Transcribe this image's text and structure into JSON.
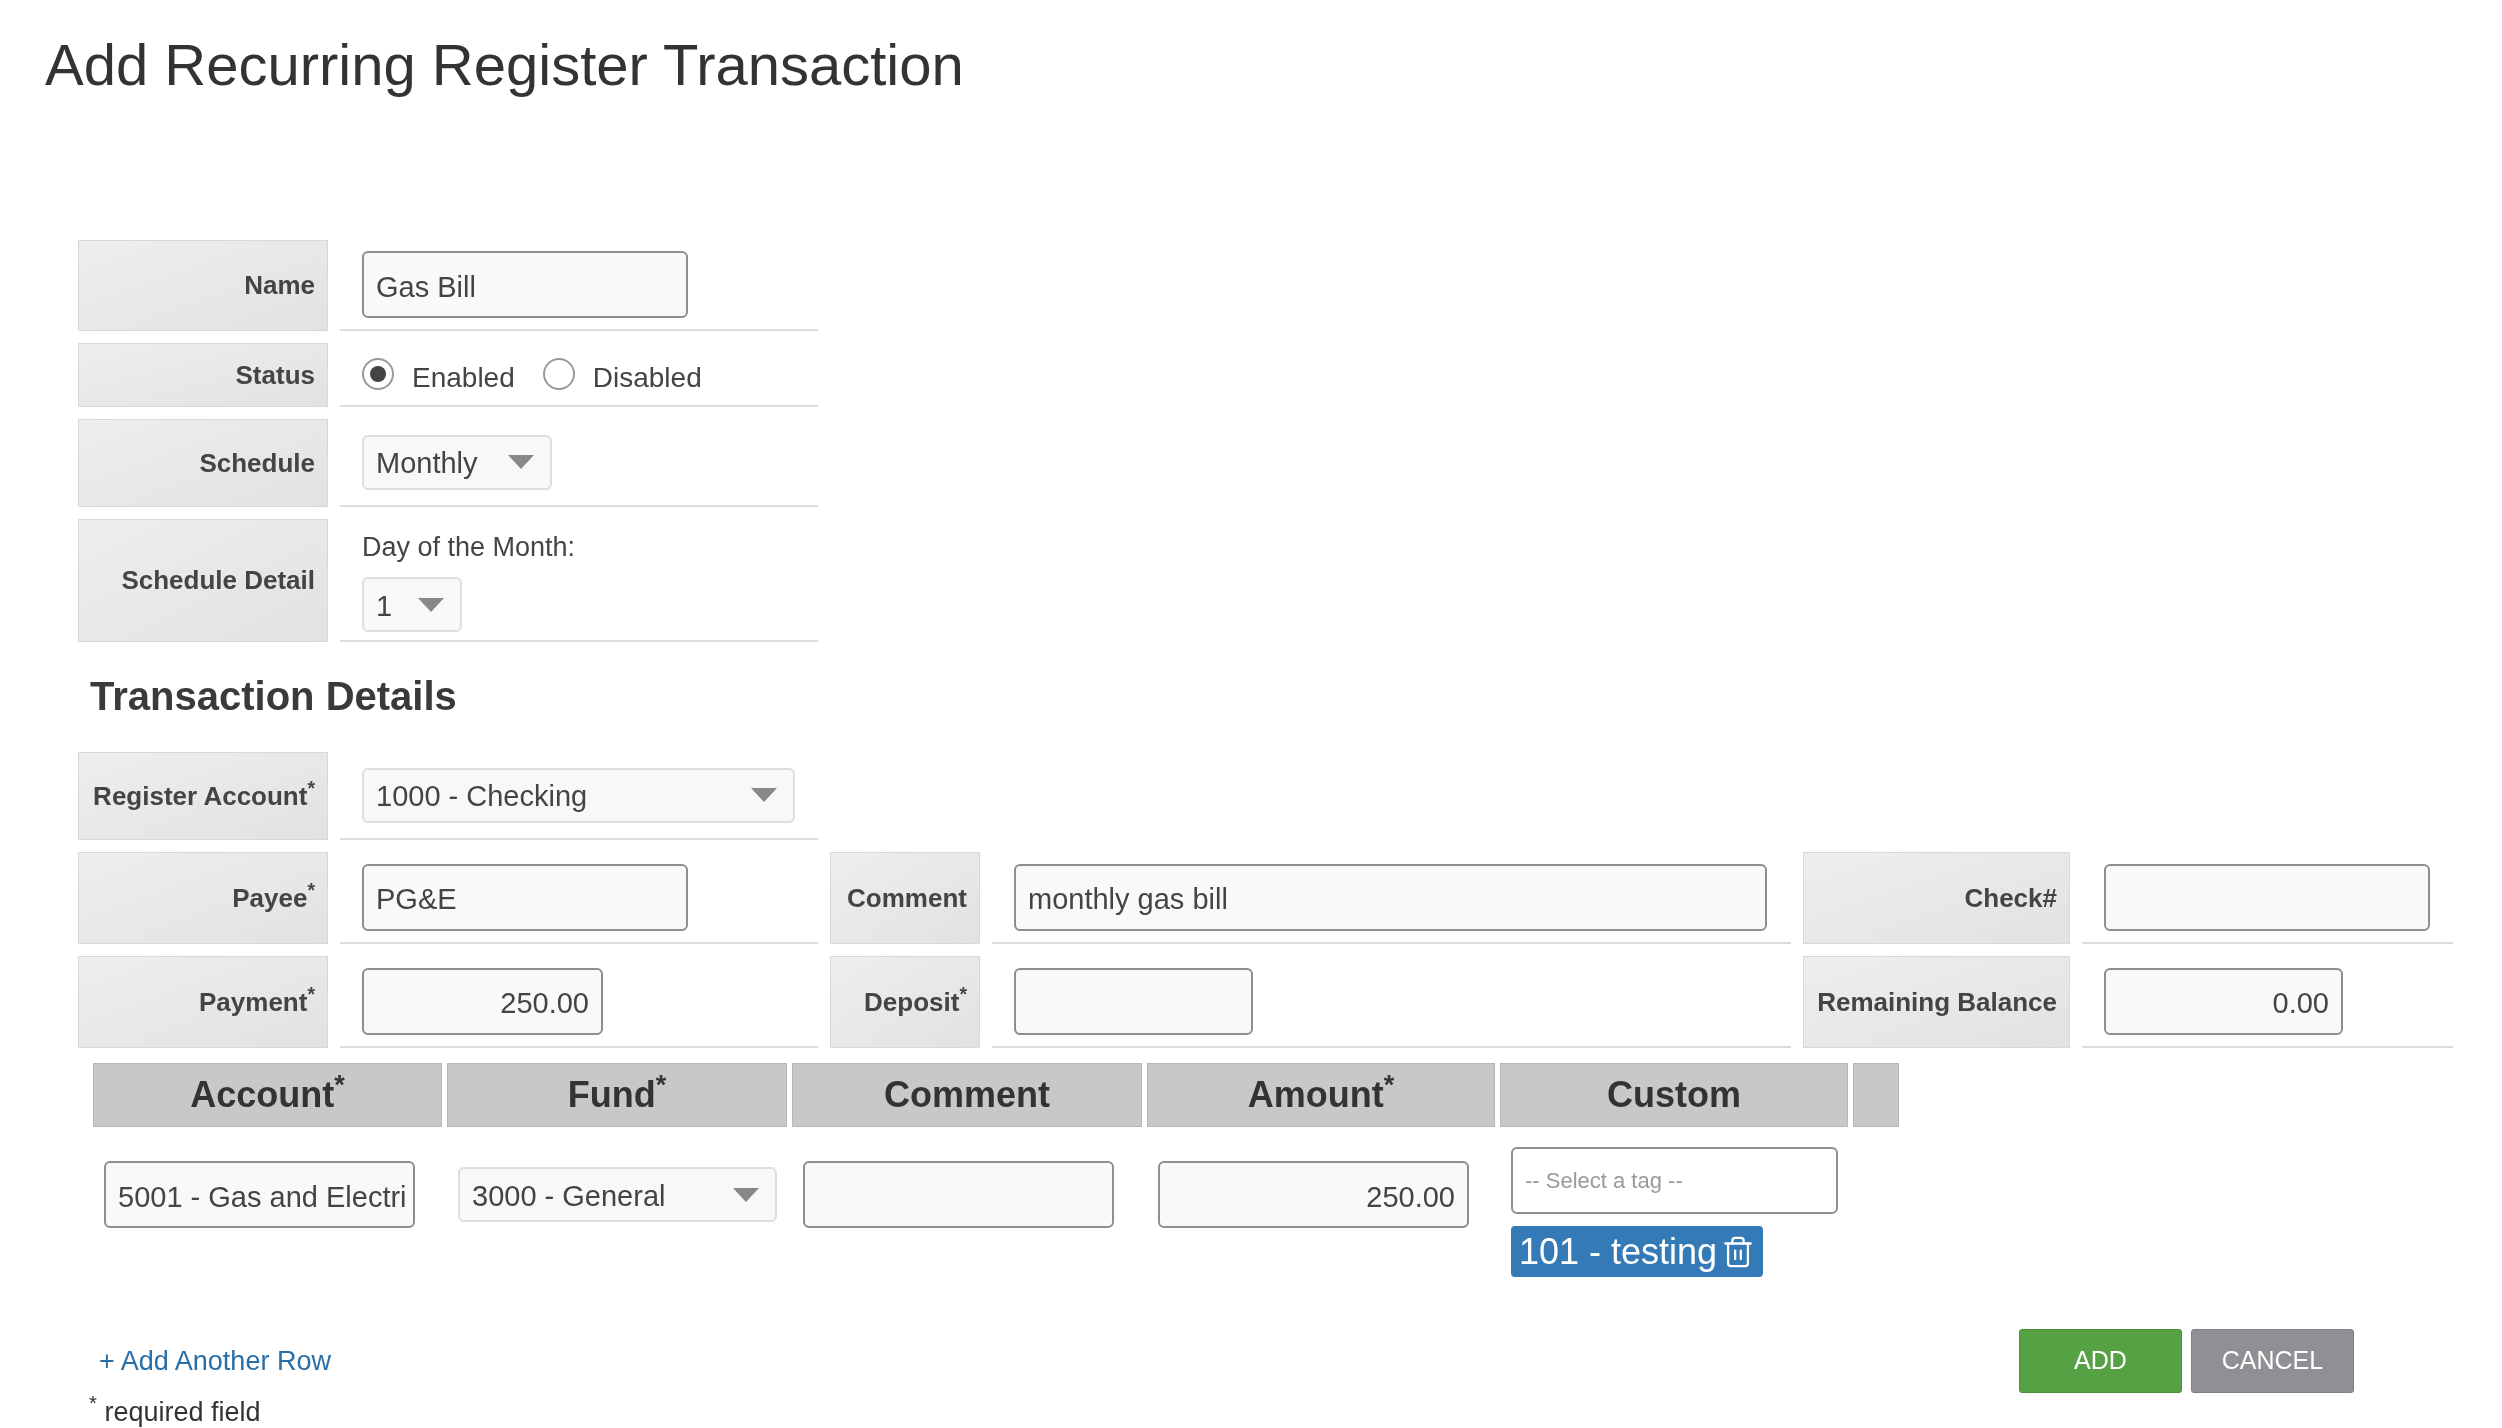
{
  "title": "Add Recurring Register Transaction",
  "schedule_form": {
    "name": {
      "label": "Name",
      "value": "Gas Bill"
    },
    "status": {
      "label": "Status",
      "options": [
        {
          "label": "Enabled",
          "selected": true
        },
        {
          "label": "Disabled",
          "selected": false
        }
      ]
    },
    "schedule": {
      "label": "Schedule",
      "value": "Monthly"
    },
    "schedule_detail": {
      "label": "Schedule Detail",
      "caption": "Day of the Month:",
      "value": "1"
    }
  },
  "transaction_details": {
    "heading": "Transaction Details",
    "register_account": {
      "label": "Register Account$^{*}$",
      "value": "1000 - Checking"
    },
    "field_rows": [
      [
        {
          "label": "Payee$^{*}$",
          "kind": "text",
          "value": "PG&E"
        },
        {
          "label": "Comment",
          "kind": "text",
          "value": "monthly gas bill"
        },
        {
          "label": "Check#",
          "kind": "text"
        }
      ],
      [
        {
          "label": "Payment$^{*}$",
          "kind": "amount",
          "value": "250.00"
        },
        {
          "label": "Deposit$^{*}$",
          "kind": "amount"
        },
        {
          "label": "Remaining Balance",
          "kind": "amount",
          "value": "0.00"
        }
      ]
    ]
  },
  "split_table": {
    "columns": [
      "Account$^{*}$",
      "Fund$^{*}$",
      "Comment",
      "Amount$^{*}$",
      "Custom"
    ],
    "rows": [
      [
        {
          "kind": "text",
          "value": "5001 - Gas and Electri"
        },
        {
          "kind": "select",
          "value": "3000 - General"
        },
        {
          "kind": "text"
        },
        {
          "kind": "amount",
          "value": "250.00"
        },
        {
          "kind": "tags",
          "placeholder": "-- Select a tag --",
          "tags": [
            {
              "label": "101 - testing"
            }
          ]
        }
      ]
    ]
  },
  "add_row_link": "+ Add Another Row",
  "required_note": "$^{*}$ required field",
  "buttons": [
    {
      "label": "ADD",
      "kind": "primary"
    },
    {
      "label": "CANCEL",
      "kind": "secondary"
    }
  ]
}
